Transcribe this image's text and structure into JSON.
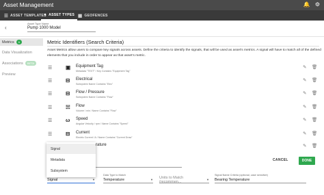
{
  "app": {
    "title": "Asset Management"
  },
  "tabs": [
    {
      "label": "ASSET TEMPLATES",
      "icon": "list-icon"
    },
    {
      "label": "ASSET TYPES",
      "icon": "tag-icon"
    },
    {
      "label": "GEOFENCES",
      "icon": "layers-icon"
    }
  ],
  "header": {
    "field_label": "Asset Type Name",
    "field_value": "Pump 1000 Model"
  },
  "sidebar": {
    "items": [
      {
        "label": "Metrics",
        "badge": "6"
      },
      {
        "label": "Data Visualization",
        "badge": ""
      },
      {
        "label": "Associations",
        "badge": "BETA"
      },
      {
        "label": "Preview",
        "badge": ""
      }
    ]
  },
  "main": {
    "title": "Metric Identifiers (Search Criteria)",
    "description": "Asset Metrics allow users to compare key signals across assets. Define the criteria to identify the signals, that will be used as asset's metrics. A signal will have to match all of the defined elements that you include in order to appear as that asset's metric."
  },
  "metrics": [
    {
      "name": "Equipment Tag",
      "sub": "Metadata \"TEXT\" / Key Contains \"Equipment Tag\"",
      "icon": "metadata-icon"
    },
    {
      "name": "Electrical",
      "sub": "Subsystem Name Contains \"Elec\"",
      "icon": "subsystem-icon"
    },
    {
      "name": "Flow / Pressure",
      "sub": "Subsystem Name Contains \"Flow\"",
      "icon": "subsystem-icon"
    },
    {
      "name": "Flow",
      "sub": "Volume / min / Name Contains \"Flow\"",
      "icon": "flow-icon"
    },
    {
      "name": "Speed",
      "sub": "Angular Velocity / rpm / Name Contains \"Speed\"",
      "icon": "speed-icon"
    },
    {
      "name": "Current",
      "sub": "Electric Current / A / Name Contains \"Current Draw\"",
      "icon": "current-icon"
    }
  ],
  "hidden_row_partial": "rature",
  "actions": {
    "cancel": "CANCEL",
    "done": "DONE"
  },
  "dropdown": {
    "options": [
      "Signal",
      "Metadata",
      "Subsystem"
    ],
    "selected": "Signal"
  },
  "form": {
    "type_value": "Signal",
    "data_type_label": "Data Type to Match",
    "data_type_value": "Temperature",
    "units_placeholder": "Units to Match (recommen...",
    "signal_name_label": "Signal Name Criteria (optional, case sensitive)",
    "signal_name_value": "Bearing Temperature"
  },
  "colors": {
    "appbar": "#4a4a4a",
    "tabbar": "#3a3a3a",
    "accent_green": "#2fa84f"
  }
}
